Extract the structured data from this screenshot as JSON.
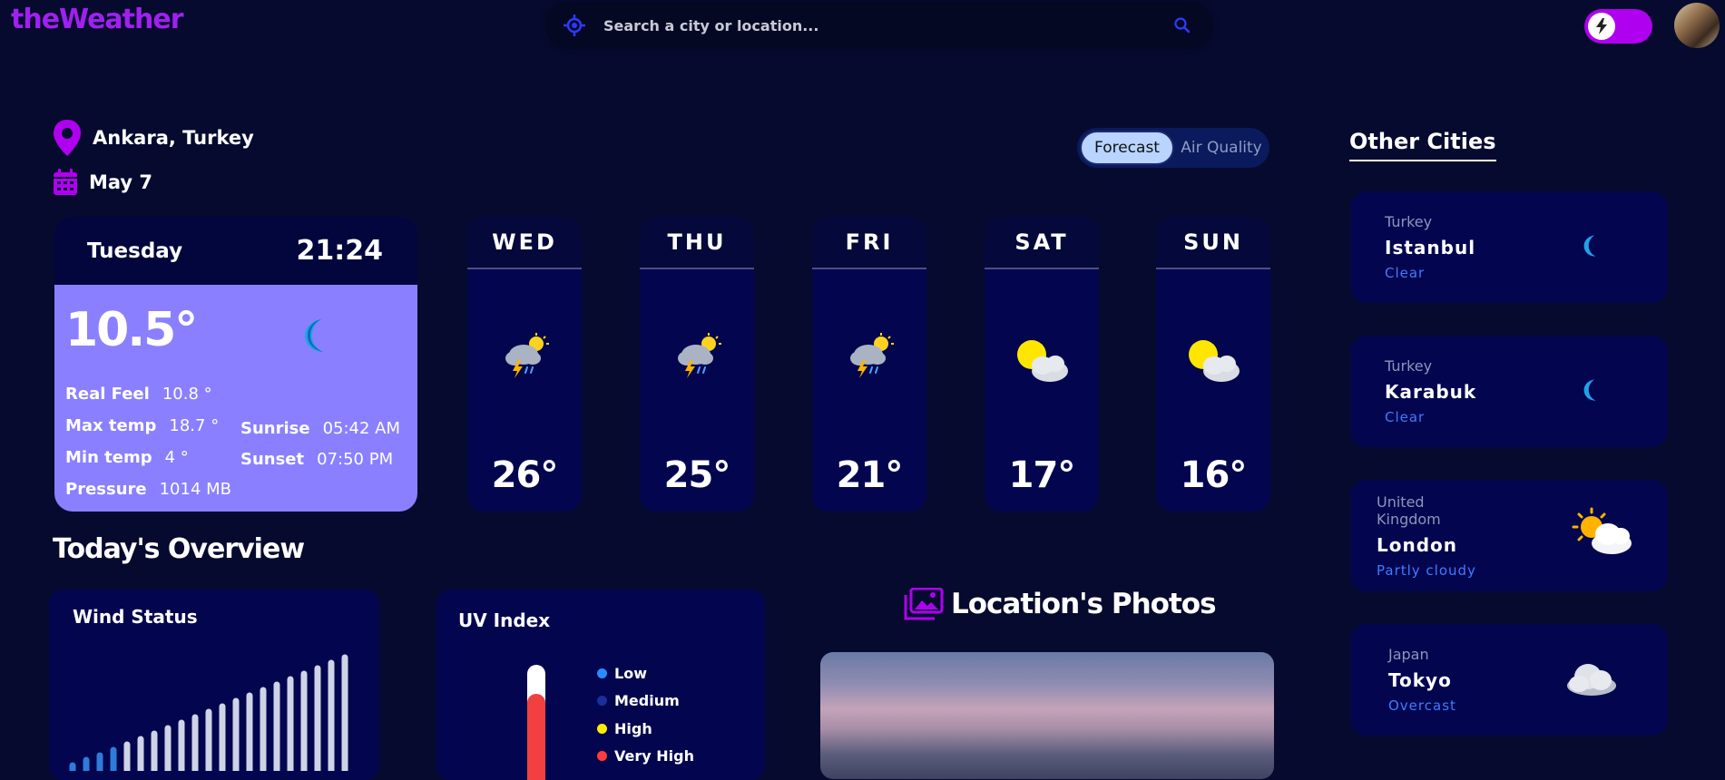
{
  "brand": "theWeather",
  "search": {
    "placeholder": "Search a city or location..."
  },
  "location": {
    "name": "Ankara, Turkey",
    "date": "May 7"
  },
  "view_tabs": [
    {
      "label": "Forecast",
      "active": true
    },
    {
      "label": "Air Quality",
      "active": false
    }
  ],
  "today": {
    "day": "Tuesday",
    "time": "21:24",
    "temp": "10.5°",
    "stats": {
      "real_feel_label": "Real Feel",
      "real_feel": "10.8 °",
      "max_label": "Max temp",
      "max": "18.7 °",
      "min_label": "Min temp",
      "min": "4 °",
      "pressure_label": "Pressure",
      "pressure": "1014 MB",
      "sunrise_label": "Sunrise",
      "sunrise": "05:42 AM",
      "sunset_label": "Sunset",
      "sunset": "07:50 PM"
    }
  },
  "forecast": [
    {
      "day": "WED",
      "temp": "26°",
      "icon": "thunderstorm-sun-icon"
    },
    {
      "day": "THU",
      "temp": "25°",
      "icon": "thunderstorm-sun-icon"
    },
    {
      "day": "FRI",
      "temp": "21°",
      "icon": "thunderstorm-sun-icon"
    },
    {
      "day": "SAT",
      "temp": "17°",
      "icon": "partly-cloudy-icon"
    },
    {
      "day": "SUN",
      "temp": "16°",
      "icon": "partly-cloudy-icon"
    }
  ],
  "overview": {
    "title": "Today's Overview",
    "wind_title": "Wind Status",
    "uv_title": "UV Index",
    "uv_legend": [
      {
        "label": "Low",
        "color": "#2a8cff"
      },
      {
        "label": "Medium",
        "color": "#1a2f9a"
      },
      {
        "label": "High",
        "color": "#ffee00"
      },
      {
        "label": "Very High",
        "color": "#ff3b3b"
      }
    ],
    "photos_title": "Location's Photos"
  },
  "other_cities": {
    "title": "Other Cities",
    "items": [
      {
        "country": "Turkey",
        "city": "Istanbul",
        "condition": "Clear",
        "icon": "moon-icon"
      },
      {
        "country": "Turkey",
        "city": "Karabuk",
        "condition": "Clear",
        "icon": "moon-icon"
      },
      {
        "country": "United Kingdom",
        "city": "London",
        "condition": "Partly cloudy",
        "icon": "partly-cloudy-icon"
      },
      {
        "country": "Japan",
        "city": "Tokyo",
        "condition": "Overcast",
        "icon": "cloud-icon"
      }
    ]
  },
  "colors": {
    "background": "#060a2e",
    "accent": "#a020f0",
    "card": "#03064f",
    "today_body": "#8a80ff",
    "link": "#3f7bff"
  }
}
